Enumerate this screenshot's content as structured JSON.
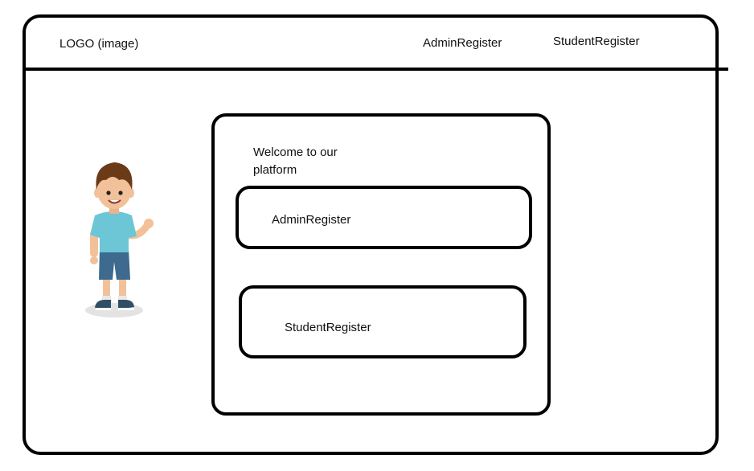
{
  "header": {
    "logo_text": "LOGO (image)",
    "nav": {
      "admin_register": "AdminRegister",
      "student_register": "StudentRegister"
    }
  },
  "main": {
    "welcome_text": "Welcome to our platform",
    "buttons": {
      "admin_register": "AdminRegister",
      "student_register": "StudentRegister"
    }
  },
  "illustration": {
    "icon": "cartoon-boy-waving",
    "colors": {
      "shirt": "#6cc6d6",
      "shorts": "#3d6a8e",
      "hair": "#6b3a17",
      "skin": "#f2c19a"
    }
  }
}
